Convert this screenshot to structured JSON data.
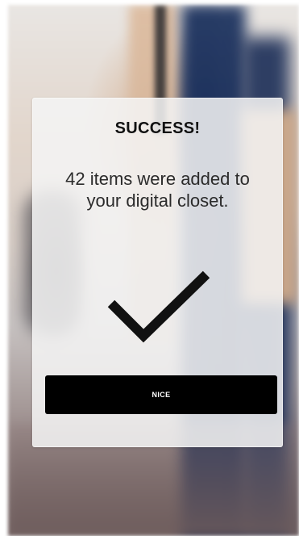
{
  "modal": {
    "title": "SUCCESS!",
    "message": "42 items were added to your digital closet.",
    "icon": "checkmark-icon",
    "button_label": "NICE"
  },
  "colors": {
    "button_bg": "#000000",
    "button_text": "#ffffff",
    "checkmark": "#111111"
  }
}
